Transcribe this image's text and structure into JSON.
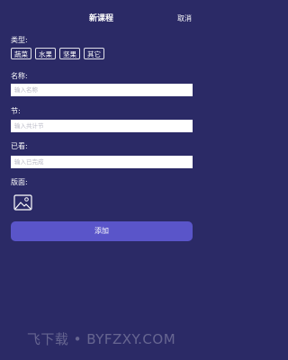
{
  "header": {
    "title": "新课程",
    "cancel_label": "取消"
  },
  "form": {
    "type_label": "类型:",
    "categories": [
      "蔬菜",
      "水果",
      "坚果",
      "其它"
    ],
    "name_label": "名称:",
    "name_placeholder": "输入名称",
    "section_label": "节:",
    "section_placeholder": "输入共计节",
    "watched_label": "已看:",
    "watched_placeholder": "输入已完成",
    "cover_label": "版面:",
    "cover_icon": "image-placeholder-icon",
    "add_label": "添加"
  },
  "watermark": "飞下载 • BYFZXY.COM",
  "colors": {
    "background": "#2b2a66",
    "button": "#5a55c9",
    "text": "#ffffff"
  }
}
